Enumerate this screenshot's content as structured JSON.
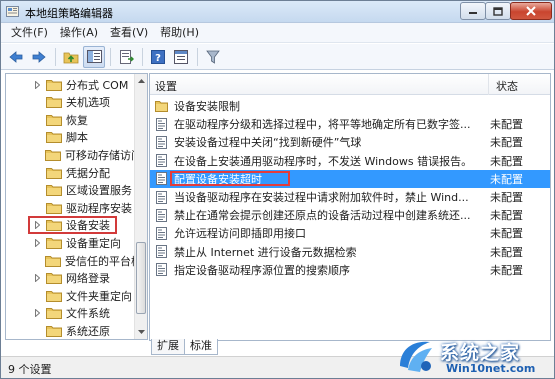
{
  "window": {
    "title": "本地组策略编辑器"
  },
  "menu": [
    {
      "label": "文件(F)"
    },
    {
      "label": "操作(A)"
    },
    {
      "label": "查看(V)"
    },
    {
      "label": "帮助(H)"
    }
  ],
  "toolbar": {
    "buttons": [
      "back-icon",
      "forward-icon",
      "up-folder-icon",
      "show-hide-tree-icon",
      "export-list-icon",
      "help-icon",
      "properties-icon",
      "filter-icon"
    ]
  },
  "tree": {
    "items": [
      {
        "label": "分布式 COM",
        "expandable": true
      },
      {
        "label": "关机选项",
        "expandable": false
      },
      {
        "label": "恢复",
        "expandable": false
      },
      {
        "label": "脚本",
        "expandable": false
      },
      {
        "label": "可移动存储访问",
        "expandable": false
      },
      {
        "label": "凭据分配",
        "expandable": false
      },
      {
        "label": "区域设置服务",
        "expandable": false
      },
      {
        "label": "驱动程序安装",
        "expandable": false
      },
      {
        "label": "设备安装",
        "expandable": true,
        "highlighted": true
      },
      {
        "label": "设备重定向",
        "expandable": true
      },
      {
        "label": "受信任的平台模",
        "expandable": false
      },
      {
        "label": "网络登录",
        "expandable": true
      },
      {
        "label": "文件夹重定向",
        "expandable": false
      },
      {
        "label": "文件系统",
        "expandable": true
      },
      {
        "label": "系统还原",
        "expandable": false
      }
    ]
  },
  "list": {
    "header_setting": "设置",
    "header_state": "状态",
    "rows": [
      {
        "name": "设备安装限制",
        "state": "",
        "type": "folder"
      },
      {
        "name": "在驱动程序分级和选择过程中，将平等地确定所有已数字签...",
        "state": "未配置",
        "type": "policy"
      },
      {
        "name": "安装设备过程中关闭“找到新硬件”气球",
        "state": "未配置",
        "type": "policy"
      },
      {
        "name": "在设备上安装通用驱动程序时，不发送 Windows 错误报告。",
        "state": "未配置",
        "type": "policy"
      },
      {
        "name": "配置设备安装超时",
        "state": "未配置",
        "type": "policy",
        "selected": true
      },
      {
        "name": "当设备驱动程序在安装过程中请求附加软件时，禁止 Wind...",
        "state": "未配置",
        "type": "policy"
      },
      {
        "name": "禁止在通常会提示创建还原点的设备活动过程中创建系统还...",
        "state": "未配置",
        "type": "policy"
      },
      {
        "name": "允许远程访问即插即用接口",
        "state": "未配置",
        "type": "policy"
      },
      {
        "name": "禁止从 Internet 进行设备元数据检索",
        "state": "未配置",
        "type": "policy"
      },
      {
        "name": "指定设备驱动程序源位置的搜索顺序",
        "state": "未配置",
        "type": "policy"
      }
    ]
  },
  "tabs": [
    {
      "label": "扩展"
    },
    {
      "label": "标准",
      "active": true
    }
  ],
  "status": {
    "text": "9 个设置"
  },
  "watermark": {
    "line1": "系统之家",
    "line2": "Win10net.com"
  },
  "colors": {
    "selection": "#3399ff",
    "highlight_box": "#d23a3a",
    "folder": "#e8c45a"
  }
}
